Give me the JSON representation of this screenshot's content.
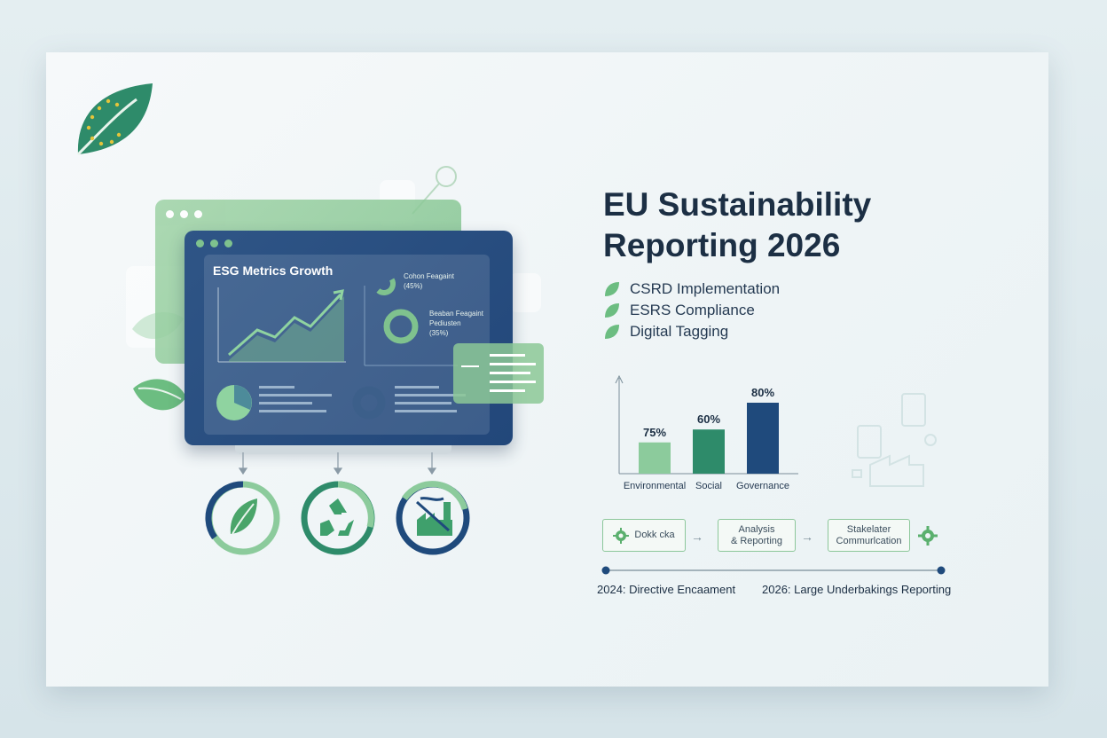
{
  "title_line1": "EU Sustainability",
  "title_line2": "Reporting 2026",
  "features": [
    "CSRD Implementation",
    "ESRS Compliance",
    "Digital Tagging"
  ],
  "dashboard": {
    "title": "ESG Metrics Growth",
    "metric1": {
      "label": "Cohon Feagaint",
      "value": "(45%)"
    },
    "metric2": {
      "label1": "Beaban Feagaint",
      "label2": "Pediusten",
      "value": "(35%)"
    }
  },
  "pillar_icons": [
    "leaf-icon",
    "recycle-icon",
    "factory-icon"
  ],
  "chart_data": {
    "type": "bar",
    "categories": [
      "Environmental",
      "Social",
      "Governance"
    ],
    "values": [
      75,
      60,
      80
    ],
    "value_labels": [
      "75%",
      "60%",
      "80%"
    ],
    "colors": [
      "#8ccb9c",
      "#2e8b6a",
      "#1f4a7c"
    ],
    "ylim": [
      0,
      100
    ],
    "grid": false
  },
  "process": {
    "step1": "Dokk cka",
    "step2": "Analysis\n& Reporting",
    "step3": "Stakelater\nCommurlcation"
  },
  "timeline": {
    "start": "2024: Directive Encaament",
    "end": "2026: Large Underbakings Reporting"
  },
  "colors": {
    "navy": "#1f4a7c",
    "green": "#7fc28e",
    "teal": "#2e8b6a"
  }
}
